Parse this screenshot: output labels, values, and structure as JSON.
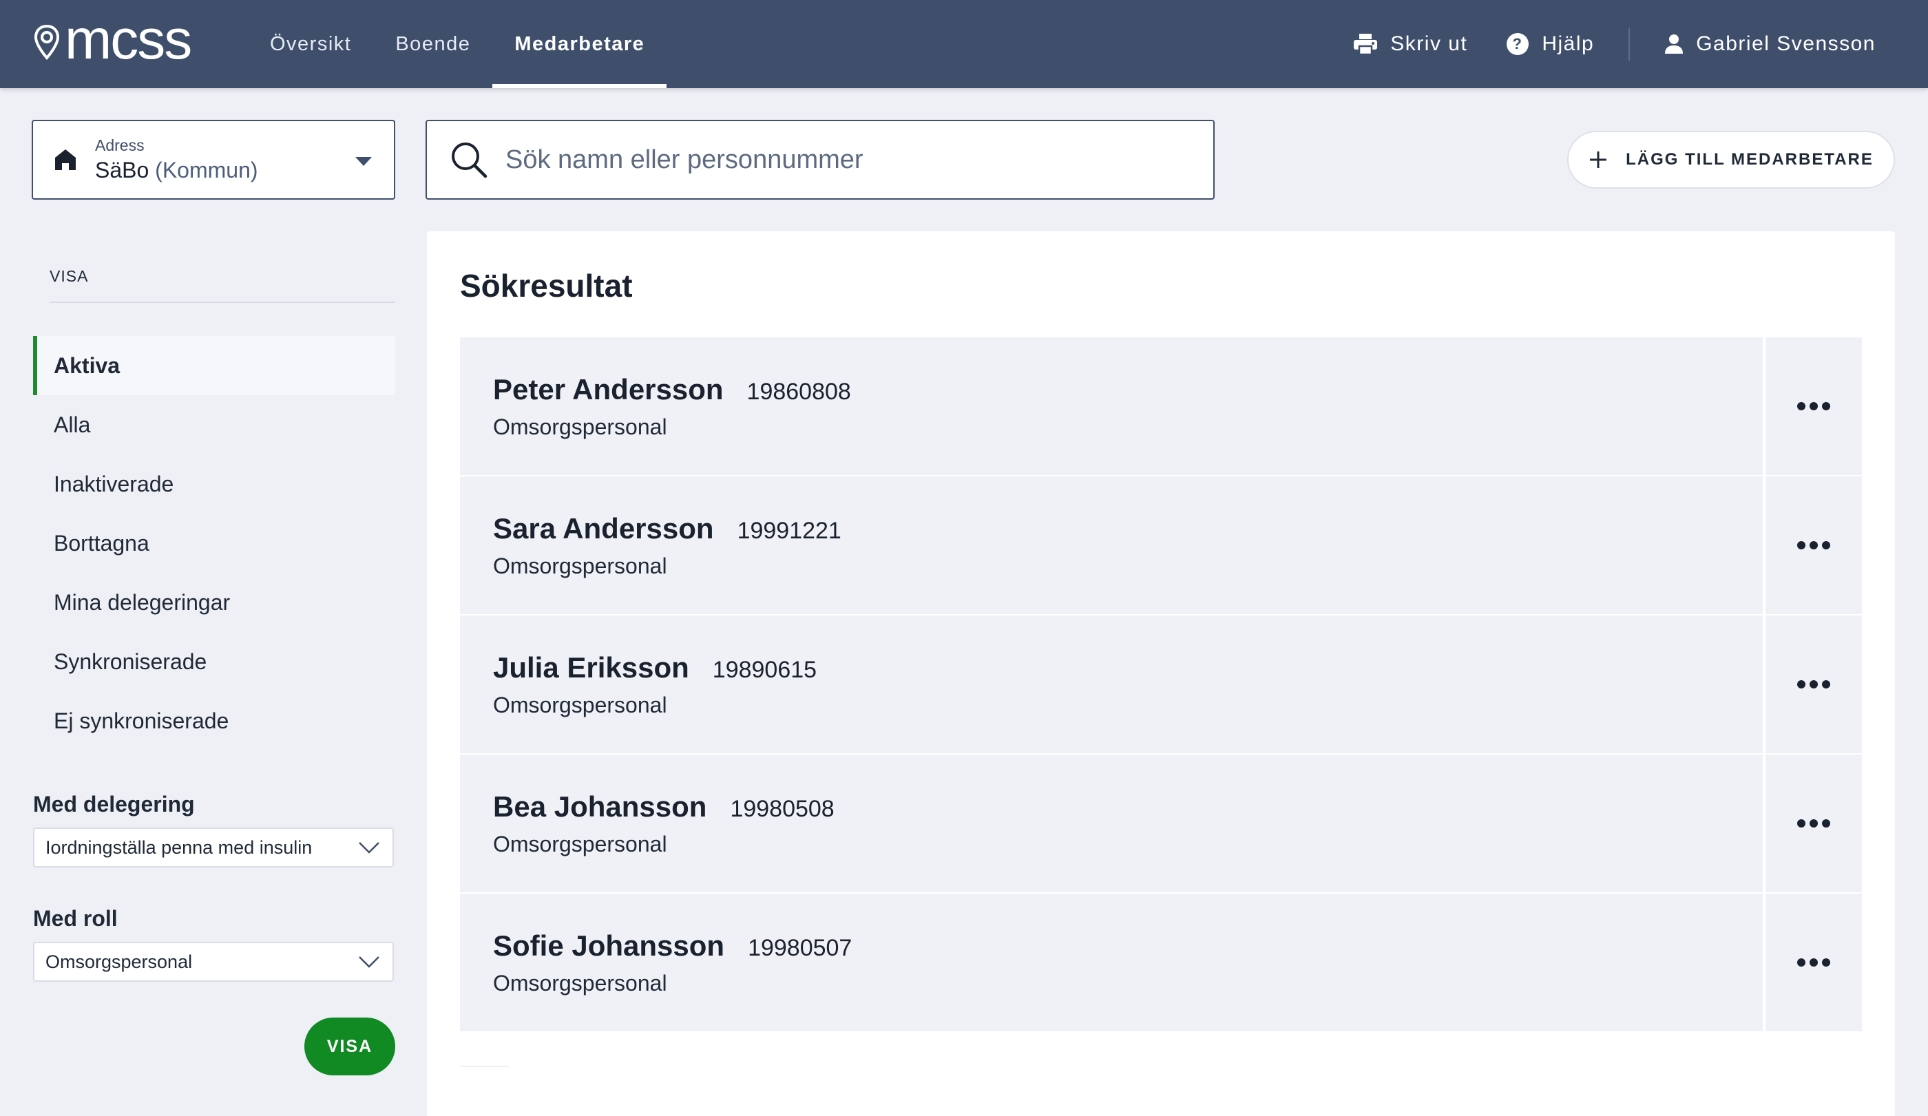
{
  "header": {
    "logo_text": "mcss",
    "nav": [
      {
        "label": "Översikt"
      },
      {
        "label": "Boende"
      },
      {
        "label": "Medarbetare",
        "active": true
      }
    ],
    "actions": {
      "print_label": "Skriv ut",
      "help_label": "Hjälp",
      "user_name": "Gabriel Svensson"
    }
  },
  "address": {
    "label": "Adress",
    "value": "SäBo",
    "qualifier": "(Kommun)"
  },
  "search": {
    "placeholder": "Sök namn eller personnummer",
    "value": ""
  },
  "add_button": {
    "label": "LÄGG TILL MEDARBETARE"
  },
  "sidebar": {
    "heading": "VISA",
    "items": [
      {
        "label": "Aktiva",
        "active": true
      },
      {
        "label": "Alla"
      },
      {
        "label": "Inaktiverade"
      },
      {
        "label": "Borttagna"
      },
      {
        "label": "Mina delegeringar"
      },
      {
        "label": "Synkroniserade"
      },
      {
        "label": "Ej synkroniserade"
      }
    ],
    "filters": {
      "delegation_label": "Med delegering",
      "delegation_value": "Iordningställa penna med insulin",
      "role_label": "Med roll",
      "role_value": "Omsorgspersonal"
    },
    "visa_button": "VISA"
  },
  "results": {
    "title": "Sökresultat",
    "rows": [
      {
        "name": "Peter Andersson",
        "pnr": "19860808",
        "role": "Omsorgspersonal"
      },
      {
        "name": "Sara Andersson",
        "pnr": "19991221",
        "role": "Omsorgspersonal"
      },
      {
        "name": "Julia Eriksson",
        "pnr": "19890615",
        "role": "Omsorgspersonal"
      },
      {
        "name": "Bea Johansson",
        "pnr": "19980508",
        "role": "Omsorgspersonal"
      },
      {
        "name": "Sofie Johansson",
        "pnr": "19980507",
        "role": "Omsorgspersonal"
      }
    ]
  },
  "colors": {
    "header_bg": "#3f4f6b",
    "accent_green": "#118a24",
    "row_bg": "#eff1f6",
    "page_bg": "#eef0f5"
  },
  "icons": [
    "location-pin-logo-icon",
    "printer-icon",
    "help-circle-icon",
    "user-icon",
    "home-icon",
    "caret-down-icon",
    "search-icon",
    "plus-icon",
    "chevron-down-icon",
    "more-dots-icon"
  ]
}
